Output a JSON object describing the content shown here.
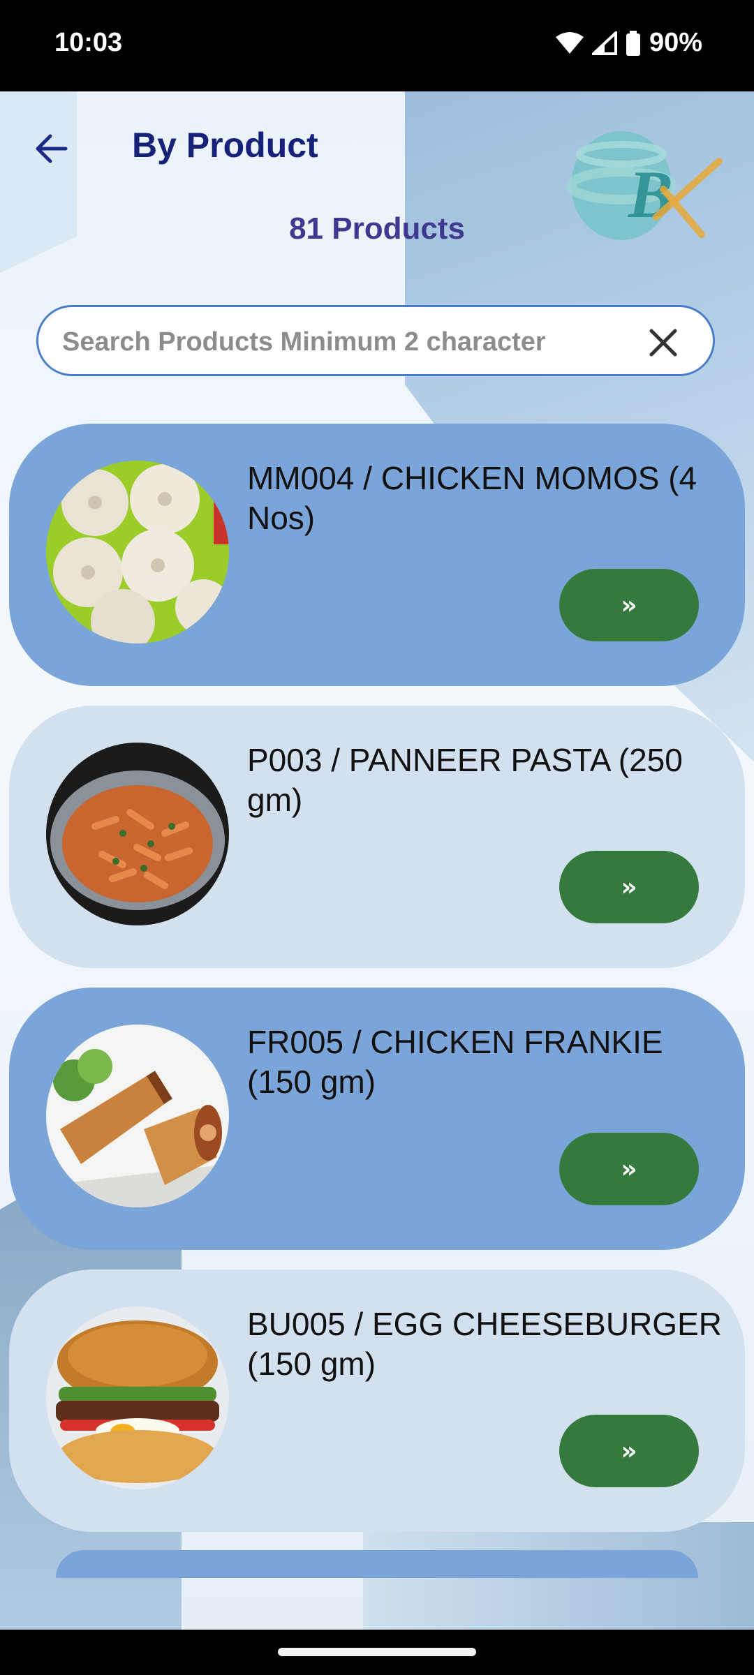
{
  "status_bar": {
    "time": "10:03",
    "battery": "90%",
    "icons": [
      "wifi-icon",
      "signal-icon",
      "battery-icon"
    ]
  },
  "header": {
    "title": "By Product",
    "back_icon": "arrow-left-icon",
    "logo_text": "B"
  },
  "summary": {
    "count_text": "81 Products"
  },
  "search": {
    "placeholder": "Search Products Minimum 2 character",
    "value": "",
    "clear_icon": "close-icon"
  },
  "products": [
    {
      "title": "MM004 /  CHICKEN MOMOS (4 Nos)",
      "button": "»",
      "image": "momos-photo"
    },
    {
      "title": "P003 /  PANNEER PASTA (250 gm)",
      "button": "»",
      "image": "pasta-photo"
    },
    {
      "title": "FR005 /  CHICKEN FRANKIE (150 gm)",
      "button": "»",
      "image": "frankie-photo"
    },
    {
      "title": "BU005 /  EGG CHEESEBURGER (150 gm)",
      "button": "»",
      "image": "burger-photo"
    }
  ],
  "colors": {
    "card_dark": "#7ba5d8",
    "card_light": "#d2e0ef",
    "button_green": "#347a3d",
    "title_navy": "#16227a"
  }
}
